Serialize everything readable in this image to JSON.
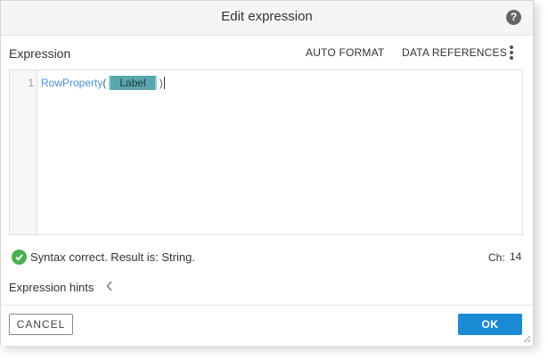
{
  "dialog": {
    "title": "Edit expression",
    "help_icon": "question-mark-icon"
  },
  "editor_toolbar": {
    "section_label": "Expression",
    "auto_format_label": "AUTO FORMAT",
    "data_references_label": "DATA REFERENCES",
    "more_icon": "vertical-dots-icon"
  },
  "editor": {
    "line_number": "1",
    "function_name": "RowProperty",
    "open_paren": "(",
    "token_label": "Label",
    "close_paren": ")"
  },
  "status": {
    "icon": "check-circle-icon",
    "message": "Syntax correct. Result is: String.",
    "ch_label": "Ch:",
    "ch_value": "14",
    "status_color": "#4caf50"
  },
  "hints": {
    "label": "Expression hints",
    "chevron_icon": "chevron-left-icon"
  },
  "footer": {
    "cancel_label": "CANCEL",
    "ok_label": "OK",
    "ok_color": "#1a8ad4"
  }
}
